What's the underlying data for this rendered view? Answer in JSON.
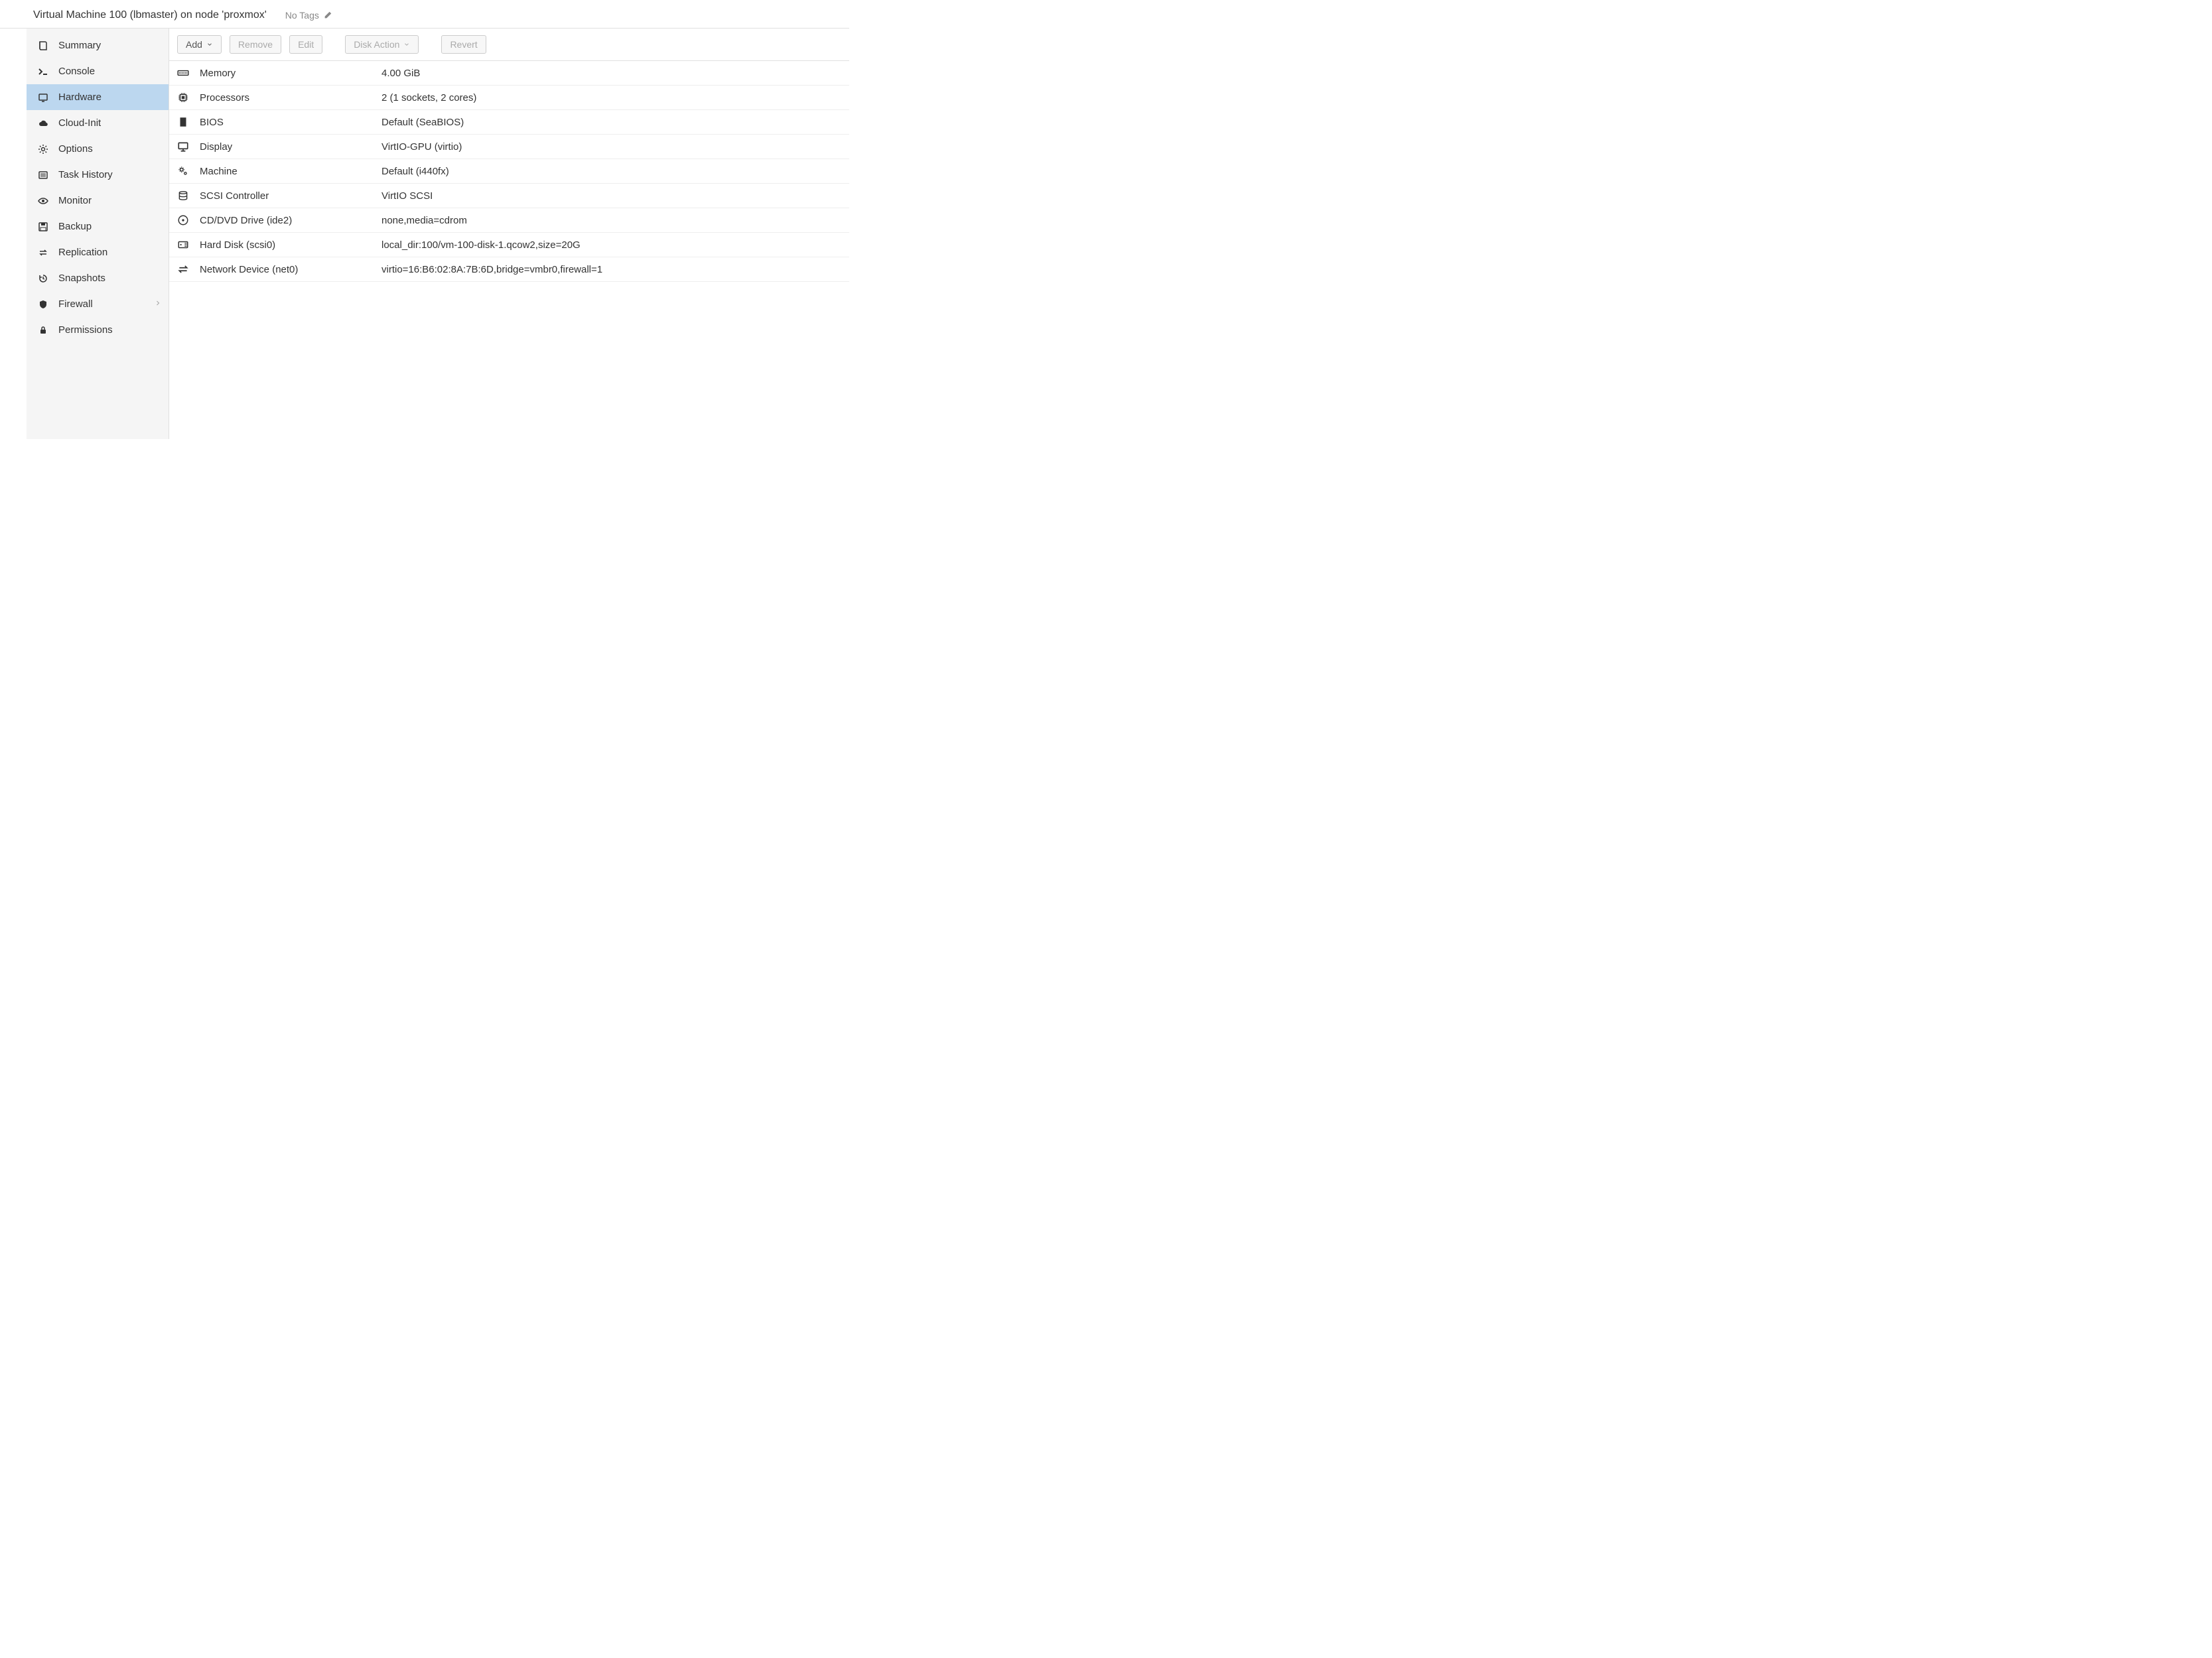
{
  "header": {
    "title": "Virtual Machine 100 (lbmaster) on node 'proxmox'",
    "no_tags": "No Tags"
  },
  "sidebar": {
    "items": [
      {
        "icon": "book",
        "label": "Summary"
      },
      {
        "icon": "terminal",
        "label": "Console"
      },
      {
        "icon": "monitor",
        "label": "Hardware"
      },
      {
        "icon": "cloud",
        "label": "Cloud-Init"
      },
      {
        "icon": "gear",
        "label": "Options"
      },
      {
        "icon": "list",
        "label": "Task History"
      },
      {
        "icon": "eye",
        "label": "Monitor"
      },
      {
        "icon": "save",
        "label": "Backup"
      },
      {
        "icon": "exchange",
        "label": "Replication"
      },
      {
        "icon": "history",
        "label": "Snapshots"
      },
      {
        "icon": "shield",
        "label": "Firewall",
        "sub": true
      },
      {
        "icon": "lock",
        "label": "Permissions"
      }
    ],
    "active_index": 2
  },
  "toolbar": {
    "add": "Add",
    "remove": "Remove",
    "edit": "Edit",
    "disk_action": "Disk Action",
    "revert": "Revert"
  },
  "hardware": [
    {
      "icon": "memory",
      "label": "Memory",
      "value": "4.00 GiB"
    },
    {
      "icon": "cpu",
      "label": "Processors",
      "value": "2 (1 sockets, 2 cores)"
    },
    {
      "icon": "bios",
      "label": "BIOS",
      "value": "Default (SeaBIOS)"
    },
    {
      "icon": "display",
      "label": "Display",
      "value": "VirtIO-GPU (virtio)"
    },
    {
      "icon": "cogs",
      "label": "Machine",
      "value": "Default (i440fx)"
    },
    {
      "icon": "stack",
      "label": "SCSI Controller",
      "value": "VirtIO SCSI"
    },
    {
      "icon": "disc",
      "label": "CD/DVD Drive (ide2)",
      "value": "none,media=cdrom"
    },
    {
      "icon": "hdd",
      "label": "Hard Disk (scsi0)",
      "value": "local_dir:100/vm-100-disk-1.qcow2,size=20G"
    },
    {
      "icon": "swap",
      "label": "Network Device (net0)",
      "value": "virtio=16:B6:02:8A:7B:6D,bridge=vmbr0,firewall=1"
    }
  ]
}
